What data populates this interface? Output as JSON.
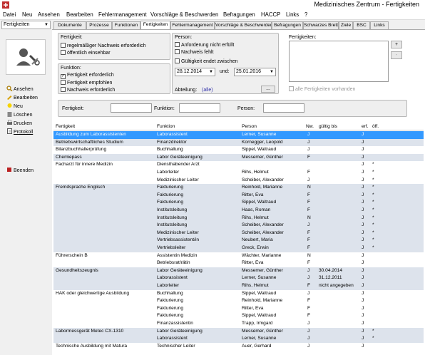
{
  "window": {
    "title": "Medizinisches Zentrum - Fertigkeiten"
  },
  "menu": [
    "Datei",
    "Neu",
    "Ansehen",
    "Bearbeiten",
    "Fehlermanagement",
    "Vorschläge & Beschwerden",
    "Befragungen",
    "HACCP",
    "Links",
    "?"
  ],
  "sidebar": {
    "selector": "Fertigkeiten",
    "items": [
      {
        "label": "Ansehen",
        "icon": "view-icon"
      },
      {
        "label": "Bearbeiten",
        "icon": "edit-icon"
      },
      {
        "label": "Neu",
        "icon": "new-icon"
      },
      {
        "label": "Löschen",
        "icon": "delete-icon"
      },
      {
        "label": "Drucken",
        "icon": "print-icon"
      },
      {
        "label": "Protokoll",
        "icon": "log-icon"
      },
      {
        "label": "Beenden",
        "icon": "exit-icon"
      }
    ]
  },
  "tabs": [
    "Dokumente",
    "Prozesse",
    "Funktionen",
    "Fertigkeiten",
    "Fehlermanagement",
    "Vorschläge & Beschwerden",
    "Befragungen",
    "Schwarzes Brett",
    "Ziele",
    "BSC",
    "Links"
  ],
  "active_tab": "Fertigkeiten",
  "filters": {
    "fertigkeit_group": {
      "title": "Fertigkeit:",
      "options": [
        {
          "label": "regelmäßiger Nachweis erforderlich",
          "checked": false
        },
        {
          "label": "öffentlich einsehbar",
          "checked": false
        }
      ]
    },
    "funktion_group": {
      "title": "Funktion:",
      "options": [
        {
          "label": "Fertigkeit erforderlich",
          "checked": true
        },
        {
          "label": "Fertigkeit empfohlen",
          "checked": false
        },
        {
          "label": "Nachweis erforderlich",
          "checked": false
        }
      ]
    },
    "person_group": {
      "title": "Person:",
      "options": [
        {
          "label": "Anforderung nicht erfüllt",
          "checked": false
        },
        {
          "label": "Nachweis fehlt",
          "checked": false
        },
        {
          "label": "Gültigkeit endet zwischen",
          "checked": false
        }
      ],
      "date_from": "28.12.2014",
      "date_and": "und:",
      "date_to": "25.01.2016",
      "abteilung_label": "Abteilung:",
      "abteilung_value": "(alle)",
      "browse": "..."
    },
    "fertigkeiten_list": {
      "title": "Fertigkeiten:",
      "add": "+",
      "remove": "-",
      "all_option": "alle Fertigkeiten vorhanden"
    },
    "search": {
      "fertigkeit_label": "Fertigkeit:",
      "funktion_label": "Funktion:",
      "person_label": "Person:"
    }
  },
  "table": {
    "columns": [
      "Fertigkeit",
      "Funktion",
      "Person",
      "Nw.",
      "gültig bis",
      "erf.",
      "öff."
    ],
    "rows": [
      {
        "fertigkeit": "Ausbildung zum Laborassistenten",
        "funktion": "Laborassistent",
        "person": "Lerner, Susanne",
        "nw": "J",
        "gueltig": "",
        "erf": "J",
        "oeff": "",
        "selected": true
      },
      {
        "fertigkeit": "Betriebswirtschaftliches Studium",
        "funktion": "Finanzdirektor",
        "person": "Kornegger, Leopold",
        "nw": "J",
        "gueltig": "",
        "erf": "J",
        "oeff": ""
      },
      {
        "fertigkeit": "Bilanzbuchhalterprüfung",
        "funktion": "Buchhaltung",
        "person": "Sippel, Waltraud",
        "nw": "J",
        "gueltig": "",
        "erf": "J",
        "oeff": ""
      },
      {
        "fertigkeit": "Chemiepass",
        "funktion": "Labor Geräteeinigung",
        "person": "Messemer, Günther",
        "nw": "F",
        "gueltig": "",
        "erf": "J",
        "oeff": ""
      },
      {
        "fertigkeit": "Facharzt für innere Medizin",
        "funktion": "Diensthabender Arzt",
        "person": "",
        "nw": "",
        "gueltig": "",
        "erf": "J",
        "oeff": "*"
      },
      {
        "fertigkeit": "",
        "funktion": "Laborleiter",
        "person": "Rihs, Helmut",
        "nw": "F",
        "gueltig": "",
        "erf": "J",
        "oeff": "*"
      },
      {
        "fertigkeit": "",
        "funktion": "Medizinischer Leiter",
        "person": "Scheiber, Alexander",
        "nw": "J",
        "gueltig": "",
        "erf": "J",
        "oeff": "*"
      },
      {
        "fertigkeit": "Fremdsprache Englisch",
        "funktion": "Fakturierung",
        "person": "Reinhold, Marianne",
        "nw": "N",
        "gueltig": "",
        "erf": "J",
        "oeff": "*"
      },
      {
        "fertigkeit": "",
        "funktion": "Fakturierung",
        "person": "Ritter, Eva",
        "nw": "F",
        "gueltig": "",
        "erf": "J",
        "oeff": "*"
      },
      {
        "fertigkeit": "",
        "funktion": "Fakturierung",
        "person": "Sippel, Waltraud",
        "nw": "F",
        "gueltig": "",
        "erf": "J",
        "oeff": "*"
      },
      {
        "fertigkeit": "",
        "funktion": "Institutsleitung",
        "person": "Haas, Roman",
        "nw": "F",
        "gueltig": "",
        "erf": "J",
        "oeff": "*"
      },
      {
        "fertigkeit": "",
        "funktion": "Institutsleitung",
        "person": "Rihs, Helmut",
        "nw": "N",
        "gueltig": "",
        "erf": "J",
        "oeff": "*"
      },
      {
        "fertigkeit": "",
        "funktion": "Institutsleitung",
        "person": "Scheiber, Alexander",
        "nw": "J",
        "gueltig": "",
        "erf": "J",
        "oeff": "*"
      },
      {
        "fertigkeit": "",
        "funktion": "Medizinischer Leiter",
        "person": "Scheiber, Alexander",
        "nw": "F",
        "gueltig": "",
        "erf": "J",
        "oeff": "*"
      },
      {
        "fertigkeit": "",
        "funktion": "Vertriebsassistent/in",
        "person": "Neubert, Maria",
        "nw": "F",
        "gueltig": "",
        "erf": "J",
        "oeff": "*"
      },
      {
        "fertigkeit": "",
        "funktion": "Vertriebsleiter",
        "person": "Greck, Erwin",
        "nw": "F",
        "gueltig": "",
        "erf": "J",
        "oeff": "*"
      },
      {
        "fertigkeit": "Führerschein B",
        "funktion": "Assistentin Medizin",
        "person": "Wächter, Marianne",
        "nw": "N",
        "gueltig": "",
        "erf": "J",
        "oeff": ""
      },
      {
        "fertigkeit": "",
        "funktion": "Betriebsrat/rätin",
        "person": "Ritter, Eva",
        "nw": "F",
        "gueltig": "",
        "erf": "J",
        "oeff": ""
      },
      {
        "fertigkeit": "Gesundheitszeugnis",
        "funktion": "Labor Geräteeinigung",
        "person": "Messemer, Günther",
        "nw": "J",
        "gueltig": "30.04.2014",
        "erf": "J",
        "oeff": ""
      },
      {
        "fertigkeit": "",
        "funktion": "Laborassistent",
        "person": "Lerner, Susanne",
        "nw": "J",
        "gueltig": "31.12.2011",
        "erf": "J",
        "oeff": ""
      },
      {
        "fertigkeit": "",
        "funktion": "Laborleiter",
        "person": "Rihs, Helmut",
        "nw": "F",
        "gueltig": "nicht angegeben",
        "erf": "J",
        "oeff": ""
      },
      {
        "fertigkeit": "HAK oder gleichwertige Ausbildung",
        "funktion": "Buchhaltung",
        "person": "Sippel, Waltraud",
        "nw": "J",
        "gueltig": "",
        "erf": "J",
        "oeff": ""
      },
      {
        "fertigkeit": "",
        "funktion": "Fakturierung",
        "person": "Reinhold, Marianne",
        "nw": "F",
        "gueltig": "",
        "erf": "J",
        "oeff": ""
      },
      {
        "fertigkeit": "",
        "funktion": "Fakturierung",
        "person": "Ritter, Eva",
        "nw": "F",
        "gueltig": "",
        "erf": "J",
        "oeff": ""
      },
      {
        "fertigkeit": "",
        "funktion": "Fakturierung",
        "person": "Sippel, Waltraud",
        "nw": "F",
        "gueltig": "",
        "erf": "J",
        "oeff": ""
      },
      {
        "fertigkeit": "",
        "funktion": "Finanzassistentin",
        "person": "Trapp, Irmgard",
        "nw": "J",
        "gueltig": "",
        "erf": "J",
        "oeff": ""
      },
      {
        "fertigkeit": "Labormessgerät Metec CX-1310",
        "funktion": "Labor Geräteeinigung",
        "person": "Messemer, Günther",
        "nw": "J",
        "gueltig": "",
        "erf": "J",
        "oeff": "*"
      },
      {
        "fertigkeit": "",
        "funktion": "Laborassistent",
        "person": "Lerner, Susanne",
        "nw": "J",
        "gueltig": "",
        "erf": "J",
        "oeff": "*"
      },
      {
        "fertigkeit": "Technische Ausbildung mit Matura",
        "funktion": "Technischer Leiter",
        "person": "Auer, Gerhard",
        "nw": "J",
        "gueltig": "",
        "erf": "J",
        "oeff": ""
      }
    ]
  },
  "colors": {
    "selected_row": "#3399ff",
    "alt_row": "#dde3ec"
  }
}
